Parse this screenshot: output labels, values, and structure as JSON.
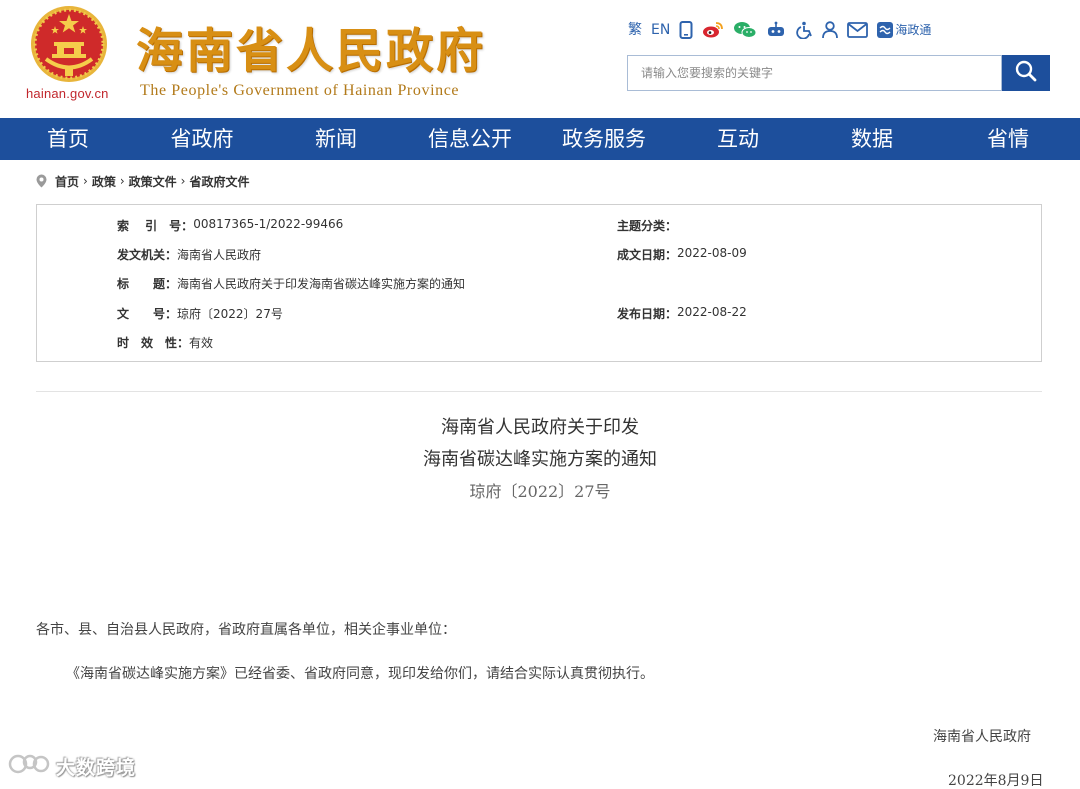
{
  "header": {
    "site_domain": "hainan.gov.cn",
    "site_name": "海南省人民政府",
    "site_name_en": "The People's Government  of Hainan Province",
    "tools": [
      {
        "icon": "traditional-chinese-icon",
        "label": "繁"
      },
      {
        "icon": "english-icon",
        "label": "EN"
      },
      {
        "icon": "mobile-icon",
        "label": ""
      },
      {
        "icon": "weibo-icon",
        "label": ""
      },
      {
        "icon": "wechat-icon",
        "label": ""
      },
      {
        "icon": "robot-icon",
        "label": ""
      },
      {
        "icon": "accessibility-icon",
        "label": ""
      },
      {
        "icon": "user-icon",
        "label": ""
      },
      {
        "icon": "mail-icon",
        "label": ""
      },
      {
        "icon": "haizhengtong-icon",
        "label": "海政通"
      }
    ],
    "search": {
      "placeholder": "请输入您要搜索的关键字",
      "value": ""
    }
  },
  "nav": {
    "items": [
      "首页",
      "省政府",
      "新闻",
      "信息公开",
      "政务服务",
      "互动",
      "数据",
      "省情"
    ]
  },
  "breadcrumb": [
    "首页",
    "政策",
    "政策文件",
    "省政府文件"
  ],
  "meta": {
    "index_label": "索　 引　号：",
    "index_value": "00817365-1/2022-99466",
    "category_label": "主题分类：",
    "category_value": "",
    "issuer_label": "发文机关：",
    "issuer_value": "海南省人民政府",
    "date_made_label": "成文日期：",
    "date_made_value": "2022-08-09",
    "title_label": "标　　题：",
    "title_value": "海南省人民政府关于印发海南省碳达峰实施方案的通知",
    "docno_label": "文　　号：",
    "docno_value": "琼府〔2022〕27号",
    "publish_label": "发布日期：",
    "publish_value": "2022-08-22",
    "validity_label": "时　效　性：",
    "validity_value": "有效"
  },
  "article": {
    "title_line1": "海南省人民政府关于印发",
    "title_line2": "海南省碳达峰实施方案的通知",
    "doc_number": "琼府〔2022〕27号",
    "salutation": "各市、县、自治县人民政府，省政府直属各单位，相关企事业单位：",
    "body": "《海南省碳达峰实施方案》已经省委、省政府同意，现印发给你们，请结合实际认真贯彻执行。",
    "signer": "海南省人民政府",
    "date": "2022年8月9日"
  },
  "watermark": {
    "text": "大数跨境"
  },
  "colors": {
    "primary_blue": "#1d4f9c",
    "gold": "#d88f14",
    "emblem_red": "#c1272d"
  }
}
